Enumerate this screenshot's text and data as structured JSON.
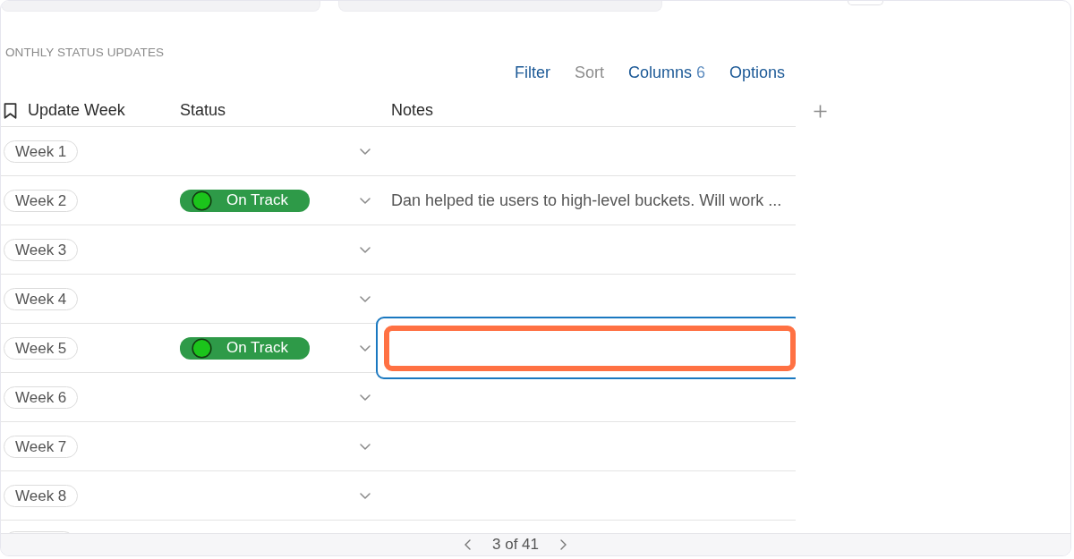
{
  "section": {
    "title": "ONTHLY STATUS UPDATES"
  },
  "toolbar": [
    {
      "label": "Filter",
      "disabled": false
    },
    {
      "label": "Sort",
      "disabled": true
    },
    {
      "label": "Columns",
      "count": "6",
      "disabled": false
    },
    {
      "label": "Options",
      "disabled": false
    }
  ],
  "table": {
    "columns": [
      {
        "label": "Update Week",
        "kind": "primary"
      },
      {
        "label": "Status",
        "kind": "field"
      },
      {
        "label": "Notes",
        "kind": "field"
      }
    ],
    "rows": [
      {
        "week": "Week 1",
        "editing": false,
        "highlighted": false
      },
      {
        "week": "Week 2",
        "status": {
          "label": "On Track",
          "color": "#2e9a48"
        },
        "notes": "Dan helped tie users to high-level buckets. Will work ...",
        "editing": false,
        "highlighted": false
      },
      {
        "week": "Week 3",
        "editing": false,
        "highlighted": false
      },
      {
        "week": "Week 4",
        "editing": false,
        "highlighted": false
      },
      {
        "week": "Week 5",
        "status": {
          "label": "On Track",
          "color": "#2e9a48"
        },
        "editing": true,
        "highlighted": true
      },
      {
        "week": "Week 6",
        "editing": false,
        "highlighted": false
      },
      {
        "week": "Week 7",
        "editing": false,
        "highlighted": false
      },
      {
        "week": "Week 8",
        "editing": false,
        "highlighted": false
      }
    ]
  },
  "pagination": {
    "text": "3 of 41"
  }
}
